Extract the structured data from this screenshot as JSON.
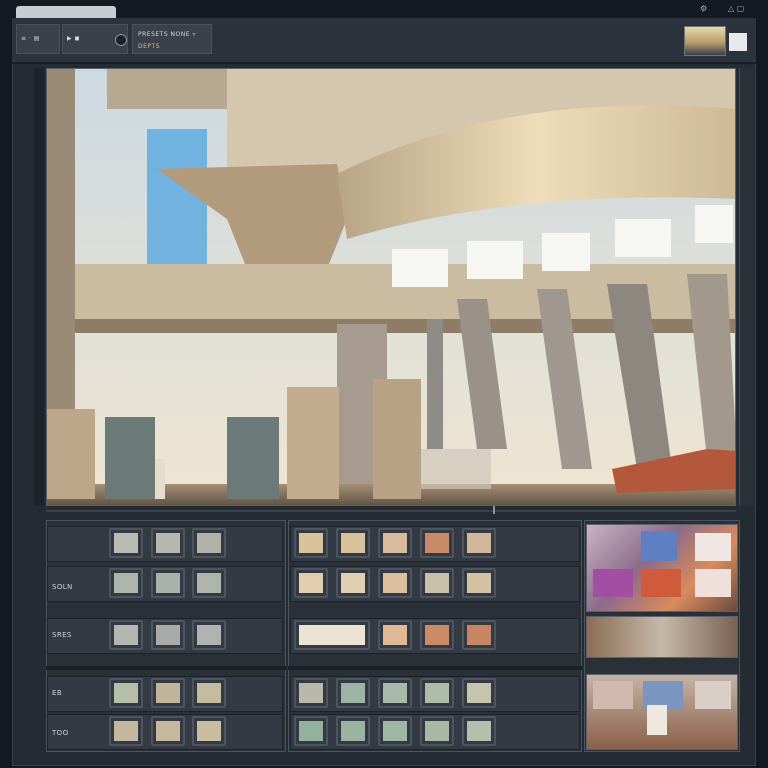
{
  "toolbar": {
    "group1_text": "≡ · ▤",
    "group2_text": "▶ ◼",
    "group3_title": "PRESETS NONE   ▿",
    "group3_sub": "DEPTS",
    "corner_left": "⚙",
    "corner_right": "△ ▢"
  },
  "panels": {
    "left": {
      "rows": [
        {
          "label": "",
          "num": "",
          "swatches": [
            "#b9bcb2",
            "#b4b8ae",
            "#b0b3a7"
          ]
        },
        {
          "label": "SOLN",
          "num": "",
          "swatches": [
            "#aeb5ad",
            "#a8b1ab",
            "#b0b5ac"
          ]
        },
        {
          "label": "SRES",
          "num": "",
          "swatches": [
            "#b3b7b0",
            "#a9aba6",
            "#b1b3b1"
          ]
        },
        {
          "label": "EB",
          "num": "",
          "swatches": [
            "#b6bda9",
            "#c0b59a",
            "#c5bb9f"
          ]
        },
        {
          "label": "TOO",
          "num": "",
          "swatches": [
            "#c4b79d",
            "#c6b89a",
            "#c9bc9f"
          ]
        }
      ],
      "caption": ""
    },
    "middle": {
      "rows_top": [
        {
          "swatches": [
            "#d8c39b",
            "#d9c29a",
            "#d8bb9b",
            "#c88a68",
            "#d2b79a"
          ]
        },
        {
          "swatches": [
            "#e2cdb0",
            "#e0cfb1",
            "#dbbf9f",
            "#c9c0a9",
            "#d3c1a2"
          ]
        },
        {
          "swatches": [
            "#ede3d2",
            "#ebdfcb",
            "#e0b896",
            "#cc8a66",
            "#c98462"
          ]
        }
      ],
      "caption": "",
      "rows_bottom": [
        {
          "swatches": [
            "#b8b9a9",
            "#9db3a3",
            "#a6b9aa",
            "#aebca9",
            "#c6c4ae"
          ]
        },
        {
          "swatches": [
            "#93b29e",
            "#9cb3a1",
            "#9eb8a5",
            "#a9b7a5",
            "#b2c0ad"
          ]
        }
      ]
    }
  }
}
